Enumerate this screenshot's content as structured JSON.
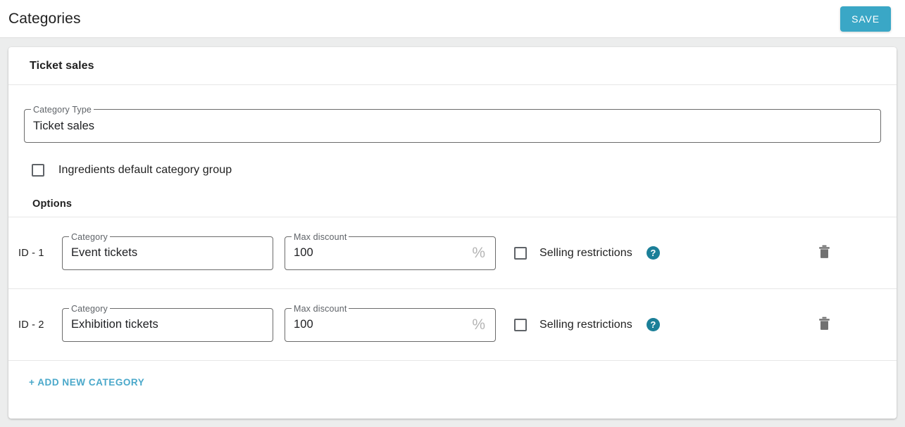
{
  "toolbar": {
    "title": "Categories",
    "save_label": "SAVE"
  },
  "card": {
    "header_title": "Ticket sales",
    "category_type": {
      "label": "Category Type",
      "value": "Ticket sales",
      "placeholder": ""
    },
    "default_group_checkbox": {
      "label": "Ingredients default category group",
      "checked": false
    },
    "options_heading": "Options",
    "option_rows": [
      {
        "id_label": "ID - 1",
        "category": {
          "label": "Category",
          "value": "Event tickets"
        },
        "max_discount": {
          "label": "Max discount",
          "value": "100",
          "suffix": "%"
        },
        "selling_restrictions": {
          "label": "Selling restrictions",
          "checked": false
        },
        "help_icon_glyph": "?",
        "delete_icon": "trash-icon"
      },
      {
        "id_label": "ID - 2",
        "category": {
          "label": "Category",
          "value": "Exhibition tickets"
        },
        "max_discount": {
          "label": "Max discount",
          "value": "100",
          "suffix": "%"
        },
        "selling_restrictions": {
          "label": "Selling restrictions",
          "checked": false
        },
        "help_icon_glyph": "?",
        "delete_icon": "trash-icon"
      }
    ],
    "add_new_label": "+ ADD NEW CATEGORY"
  },
  "colors": {
    "accent": "#3aa7c6",
    "help_icon": "#1b7f98",
    "link": "#4aa8ca",
    "page_background": "#eceded"
  }
}
